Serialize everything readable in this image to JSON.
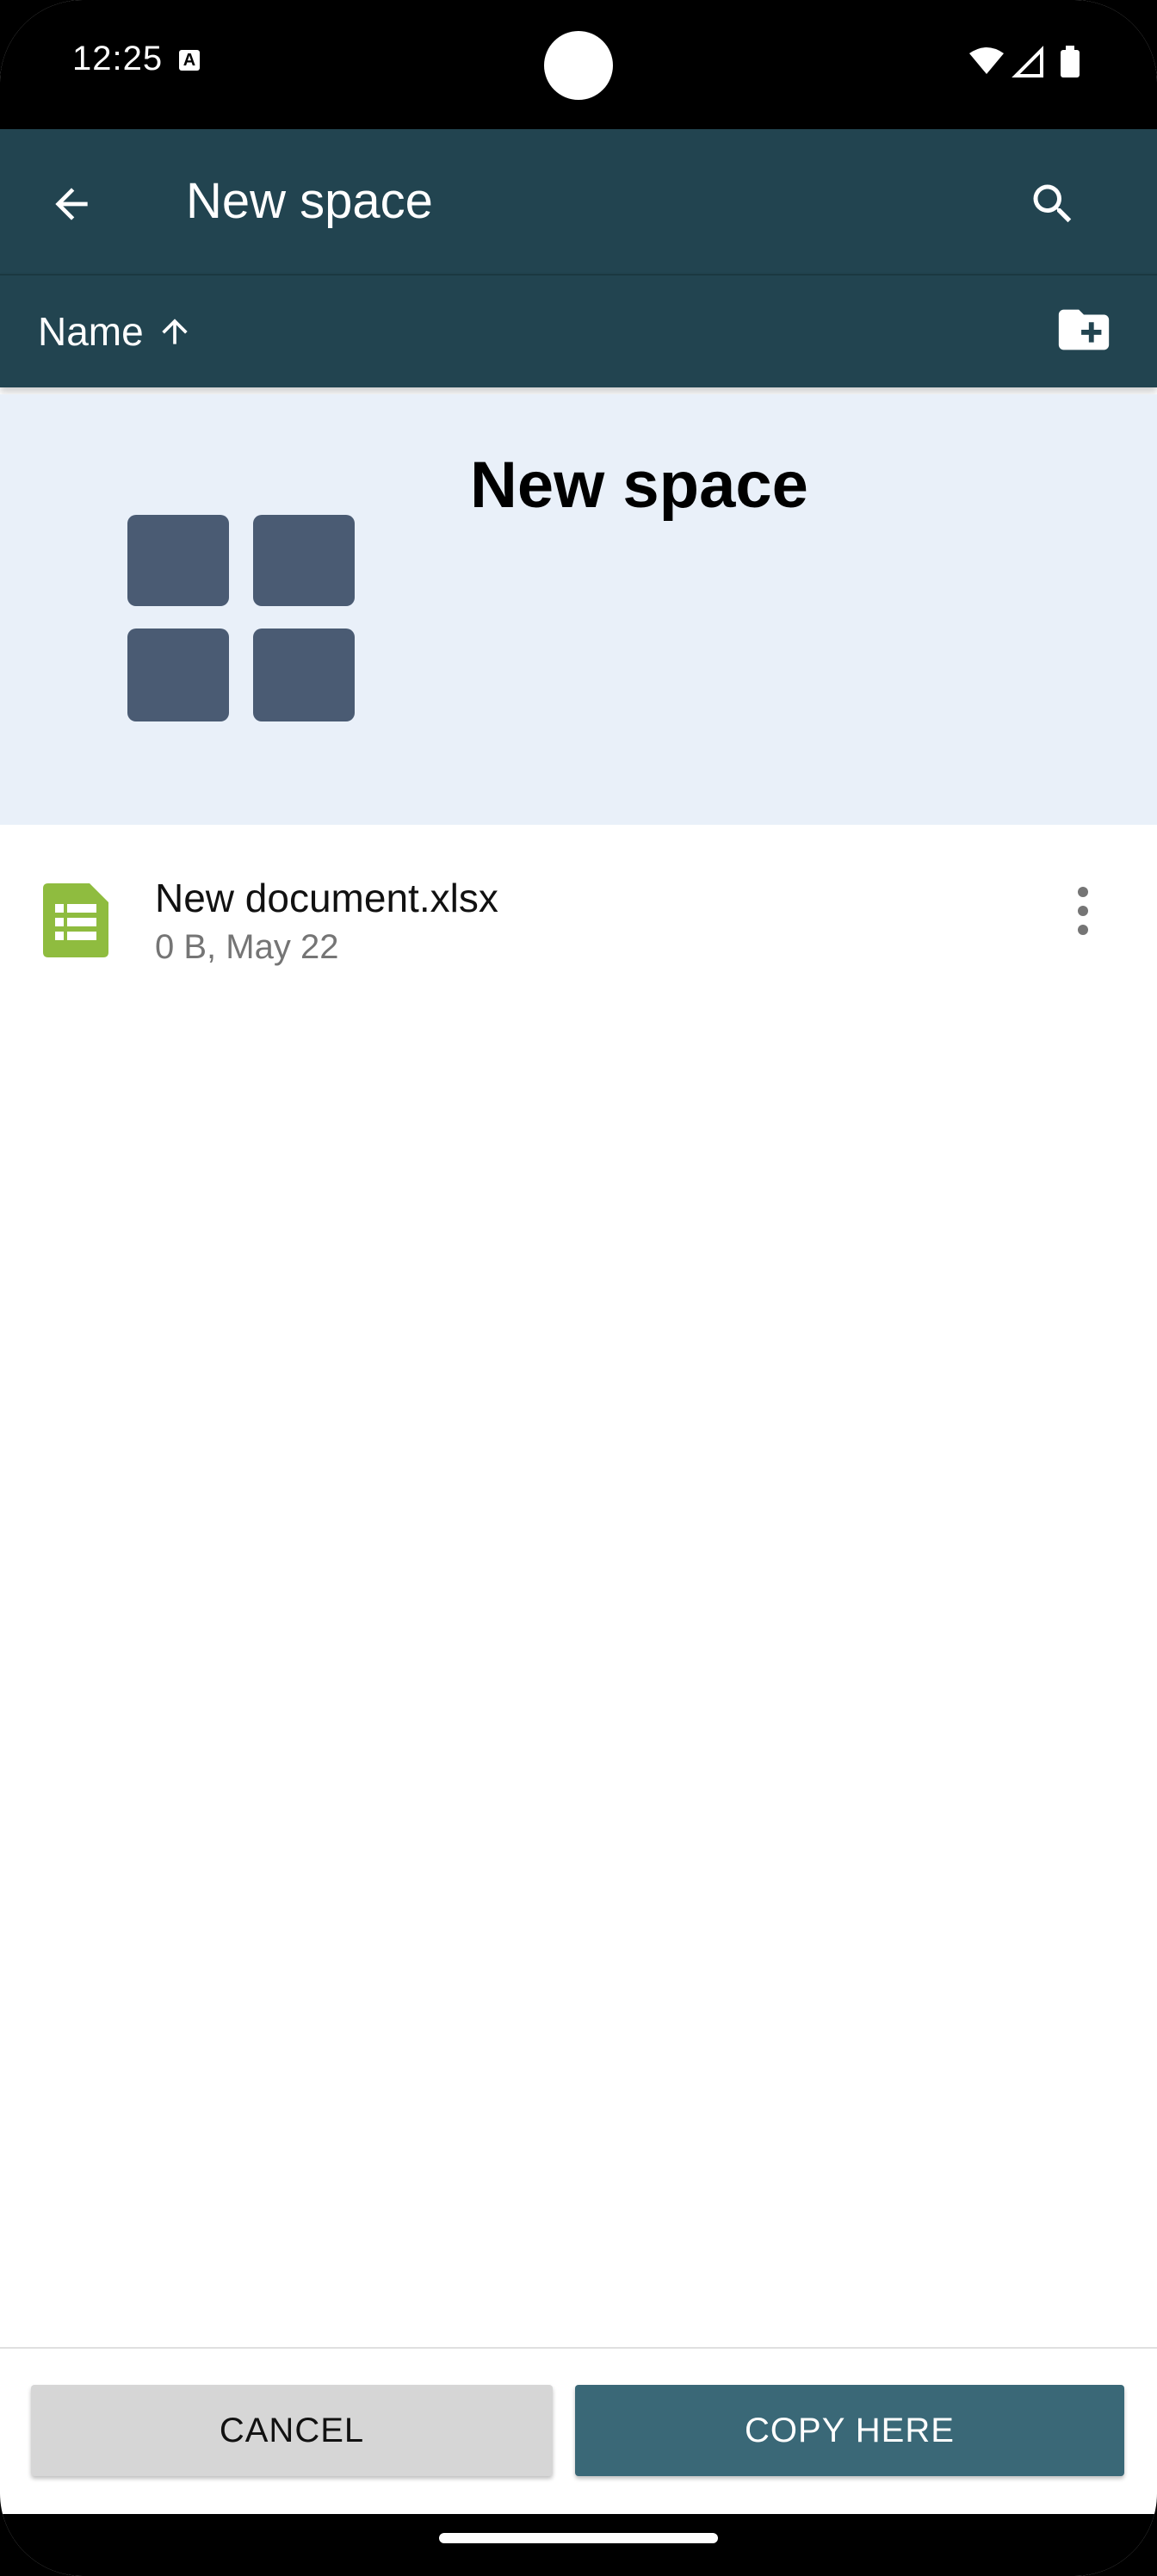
{
  "status_bar": {
    "time": "12:25",
    "notification_badge": "A"
  },
  "toolbar": {
    "title": "New space",
    "back_icon": "arrow-left-icon",
    "search_icon": "search-icon"
  },
  "sort_bar": {
    "label": "Name",
    "direction_icon": "arrow-up-icon",
    "new_folder_icon": "folder-plus-icon"
  },
  "space_header": {
    "title": "New space",
    "icon": "space-grid-icon"
  },
  "files": [
    {
      "name": "New document.xlsx",
      "meta": "0 B, May 22",
      "icon": "spreadsheet-icon"
    }
  ],
  "actions": {
    "cancel_label": "CANCEL",
    "copy_label": "COPY HERE"
  },
  "colors": {
    "toolbar_bg": "#224450",
    "header_bg": "#e9f0f9",
    "primary_button": "#3a6877",
    "spreadsheet_green": "#8fbc3f",
    "space_icon": "#4a5b73"
  }
}
